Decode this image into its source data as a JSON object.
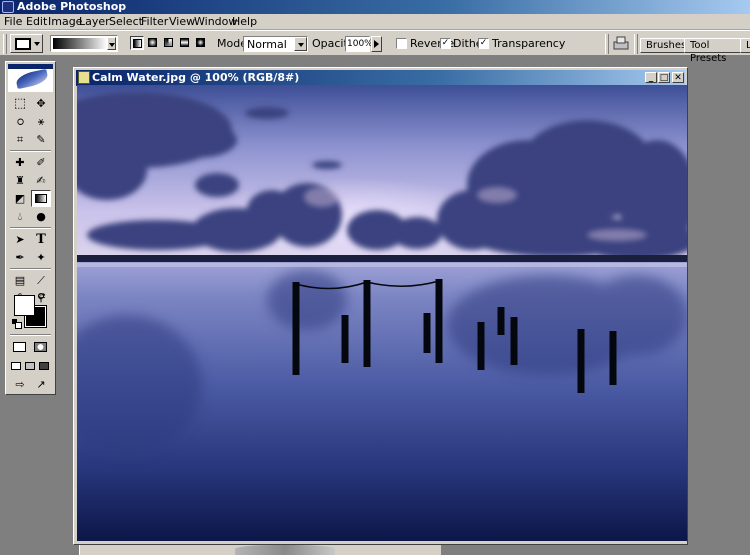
{
  "app": {
    "title": "Adobe Photoshop"
  },
  "menu": [
    "File",
    "Edit",
    "Image",
    "Layer",
    "Select",
    "Filter",
    "View",
    "Window",
    "Help"
  ],
  "options": {
    "mode_label": "Mode:",
    "mode_value": "Normal",
    "opacity_label": "Opacity:",
    "opacity_value": "100%",
    "reverse_label": "Reverse",
    "reverse_checked": false,
    "dither_label": "Dither",
    "dither_checked": true,
    "transparency_label": "Transparency",
    "transparency_checked": true,
    "checkmark": "✓"
  },
  "palette_well": {
    "tabs": [
      "Brushes",
      "Tool Presets",
      "L"
    ]
  },
  "toolbox": {
    "active_tool": "gradient-tool",
    "colors": {
      "foreground": "#ffffff",
      "background": "#000000"
    }
  },
  "document": {
    "title": "Calm Water.jpg @ 100% (RGB/8#)",
    "buttons": {
      "minimize": "_",
      "maximize": "□",
      "close": "✕"
    }
  },
  "colors": {
    "workspace": "#7f7f7f",
    "chrome": "#d4d0c8",
    "titlebar_start": "#0a246a",
    "titlebar_end": "#a6caf0",
    "sky_top": "#3e4f97",
    "sky_horizon": "#cdc6ea",
    "water_bottom": "#0b1748"
  }
}
